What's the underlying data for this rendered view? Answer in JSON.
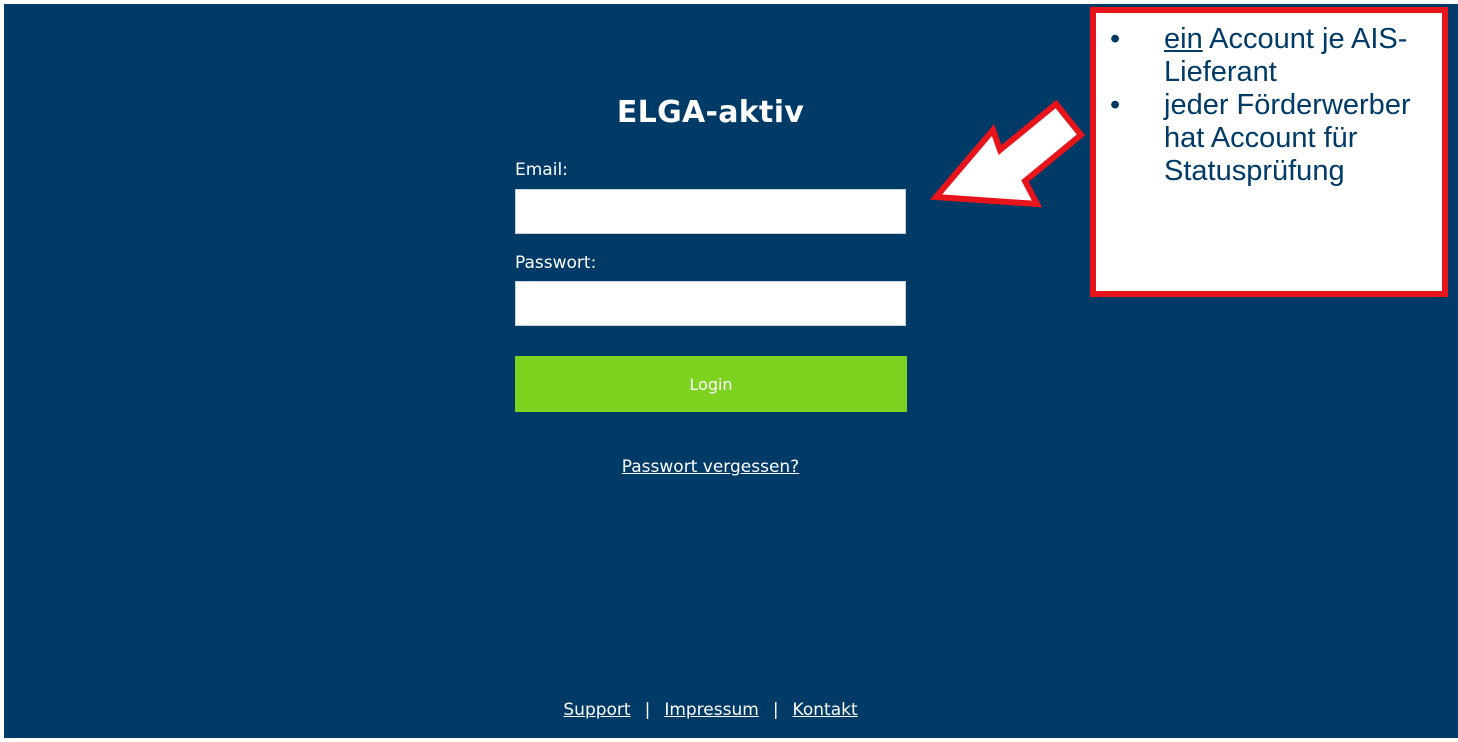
{
  "app": {
    "title": "ELGA-aktiv"
  },
  "login_form": {
    "email_label": "Email:",
    "email_value": "",
    "password_label": "Passwort:",
    "password_value": "",
    "login_button_label": "Login",
    "forgot_password_link": "Passwort vergessen?"
  },
  "footer": {
    "links": [
      "Support",
      "Impressum",
      "Kontakt"
    ],
    "separator": "|"
  },
  "callout": {
    "bullet_symbol": "•",
    "items": [
      {
        "emphasis": "ein",
        "text": " Account je AIS-Lieferant"
      },
      {
        "emphasis": "",
        "text": "jeder Förderwerber hat Account für Statusprüfung"
      }
    ]
  },
  "icons": {
    "annotation_arrow": "arrow-left-down-icon"
  },
  "colors": {
    "background": "#003A66",
    "login_button": "#7ED321",
    "callout_border": "#E8141B",
    "callout_text": "#003A66",
    "text_on_dark": "#FFFFFF"
  }
}
